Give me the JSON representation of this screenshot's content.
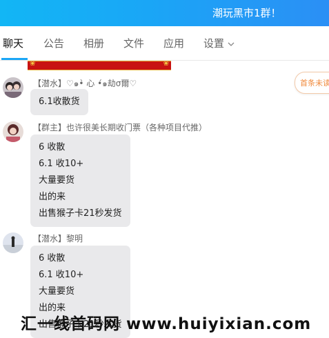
{
  "header": {
    "title": "潮玩黑市1群！"
  },
  "tabs": [
    {
      "label": "聊天"
    },
    {
      "label": "公告"
    },
    {
      "label": "相册"
    },
    {
      "label": "文件"
    },
    {
      "label": "应用"
    },
    {
      "label": "设置"
    }
  ],
  "side_pill": {
    "label": "首条未读"
  },
  "messages": [
    {
      "sender": "【潜水】♡๑•̀ 心 •́๑劫σ爾♡",
      "lines": [
        "6.1收散货"
      ]
    },
    {
      "sender": "【群主】也许很美长期收门票（各种项目代推）",
      "lines": [
        "6   收散",
        "6.1 收10+",
        "大量要货",
        "出的来",
        "出售猴子卡21秒发货"
      ]
    },
    {
      "sender": "【潜水】黎明",
      "lines": [
        "6   收散",
        "6.1 收10+",
        "大量要货",
        "出的来",
        "出售猴子卡21秒发货"
      ]
    }
  ],
  "watermark": {
    "text": "汇一线首码网 www.huiyixian.com"
  },
  "colors": {
    "header_start": "#12b6f5",
    "header_end": "#2b8ff5",
    "bubble": "#e9e9eb",
    "accent": "#1aa6f6",
    "pill_text": "#f08a3c"
  }
}
